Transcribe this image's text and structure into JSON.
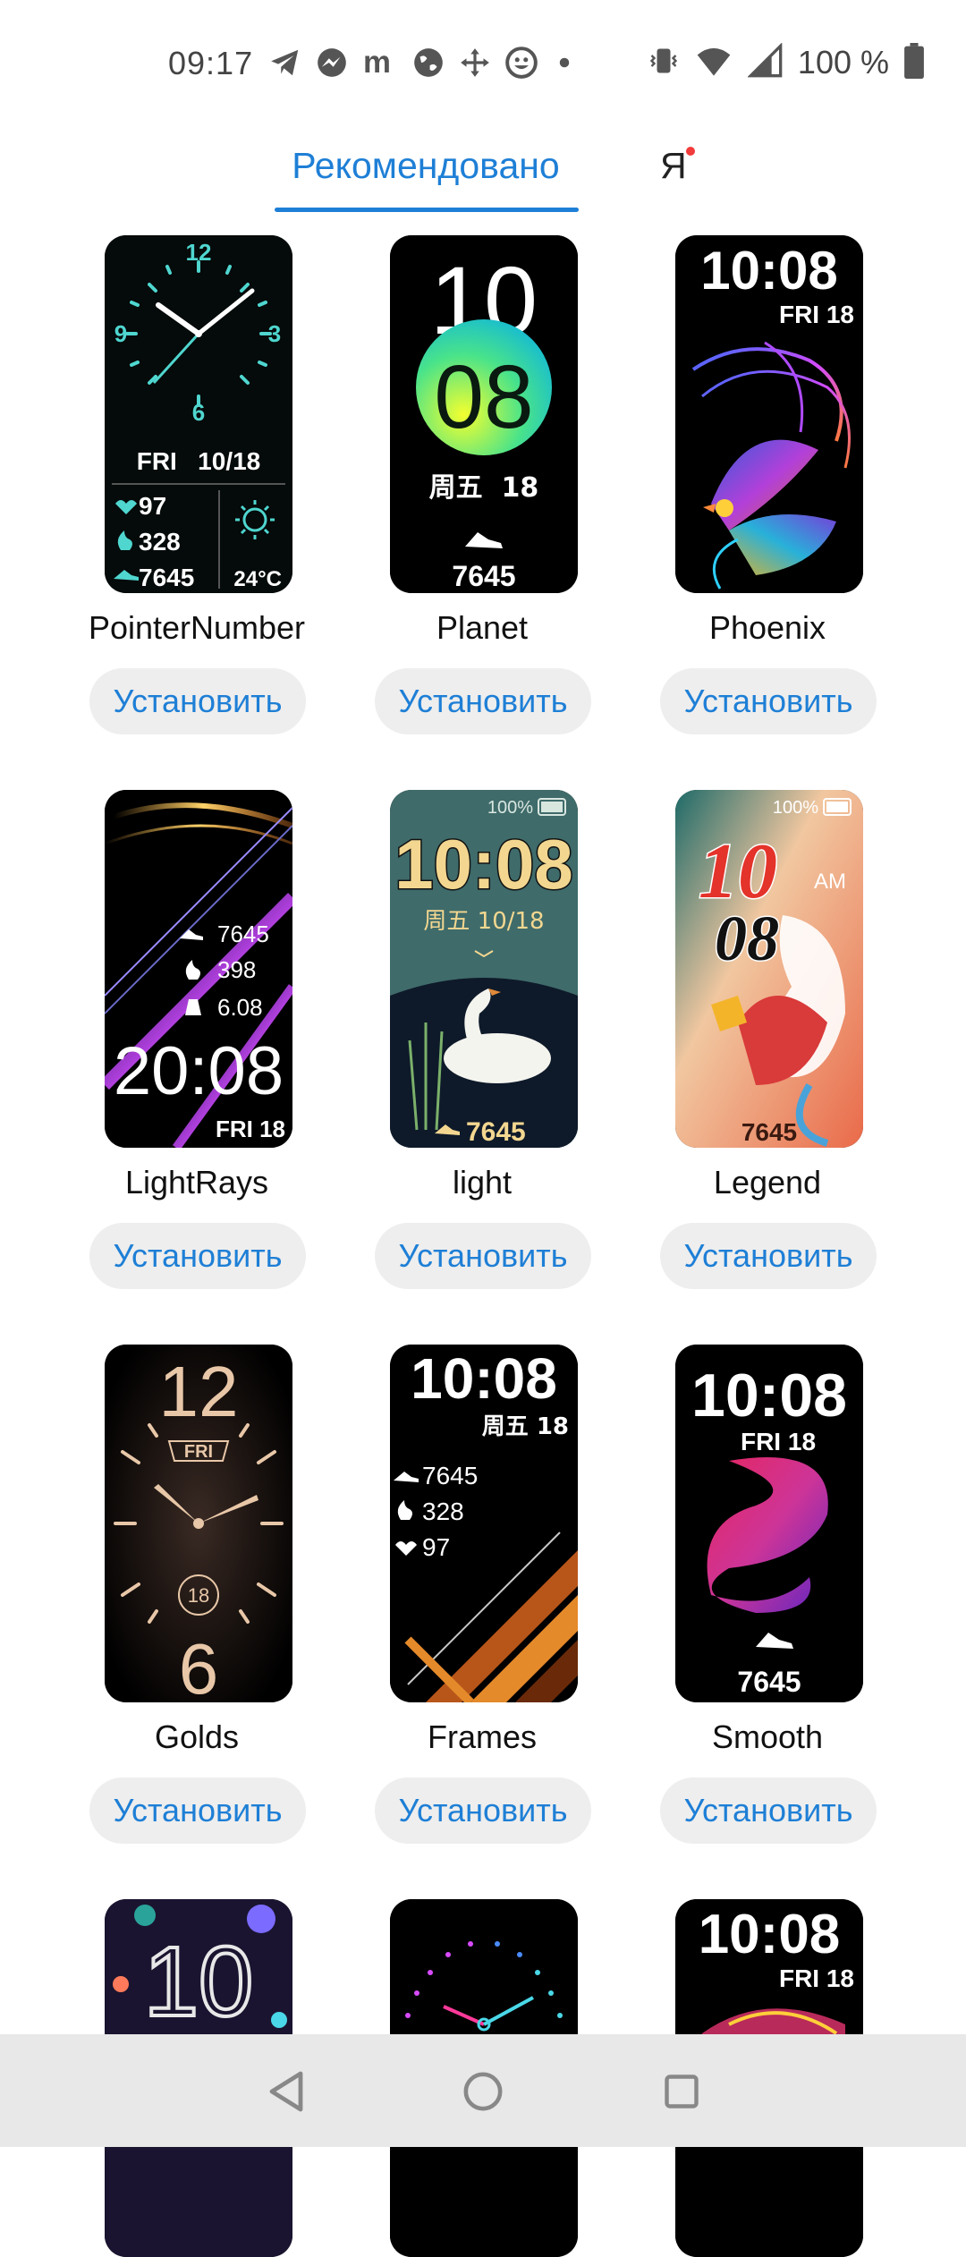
{
  "status_bar": {
    "time": "09:17",
    "battery_text": "100 %",
    "notification_icons": [
      "telegram-icon",
      "messenger-icon",
      "m-icon",
      "globe-icon",
      "move-icon",
      "emoji-icon",
      "dot-icon"
    ],
    "system_icons": [
      "vibrate-icon",
      "wifi-icon",
      "signal-icon",
      "battery-icon"
    ]
  },
  "tabs": {
    "recommended": "Рекомендовано",
    "me": "Я",
    "active": "recommended",
    "accent": "#1e7fd6"
  },
  "faces": [
    {
      "name": "PointerNumber",
      "button": "Установить",
      "date_text": "FRI   10/18",
      "heart": "97",
      "fire": "328",
      "steps": "7645",
      "temp": "24°C",
      "hour_labels": [
        "12",
        "3",
        "6",
        "9"
      ]
    },
    {
      "name": "Planet",
      "button": "Установить",
      "hour": "10",
      "minute": "08",
      "date_text": "周五  18",
      "steps": "7645"
    },
    {
      "name": "Phoenix",
      "button": "Установить",
      "time": "10:08",
      "date_text": "FRI 18"
    },
    {
      "name": "LightRays",
      "button": "Установить",
      "steps": "7645",
      "fire": "398",
      "distance": "6.08",
      "time": "20:08",
      "date_text": "FRI 18"
    },
    {
      "name": "light",
      "button": "Установить",
      "battery": "100%",
      "time": "10:08",
      "date_text": "周五 10/18",
      "steps": "7645"
    },
    {
      "name": "Legend",
      "button": "Установить",
      "battery": "100%",
      "hour": "10",
      "minute": "08",
      "ampm": "AM",
      "steps": "7645"
    },
    {
      "name": "Golds",
      "button": "Установить",
      "top_num": "12",
      "bottom_num": "6",
      "day": "FRI",
      "date_num": "18"
    },
    {
      "name": "Frames",
      "button": "Установить",
      "time": "10:08",
      "date_text": "周五 18",
      "steps": "7645",
      "fire": "328",
      "heart": "97"
    },
    {
      "name": "Smooth",
      "button": "Установить",
      "time": "10:08",
      "date_text": "FRI 18",
      "steps": "7645"
    },
    {
      "name": "",
      "button": "",
      "hour": "10"
    },
    {
      "name": "",
      "button": ""
    },
    {
      "name": "",
      "button": "",
      "time": "10:08",
      "date_text": "FRI 18"
    }
  ],
  "nav": [
    "back-icon",
    "home-icon",
    "recents-icon"
  ]
}
